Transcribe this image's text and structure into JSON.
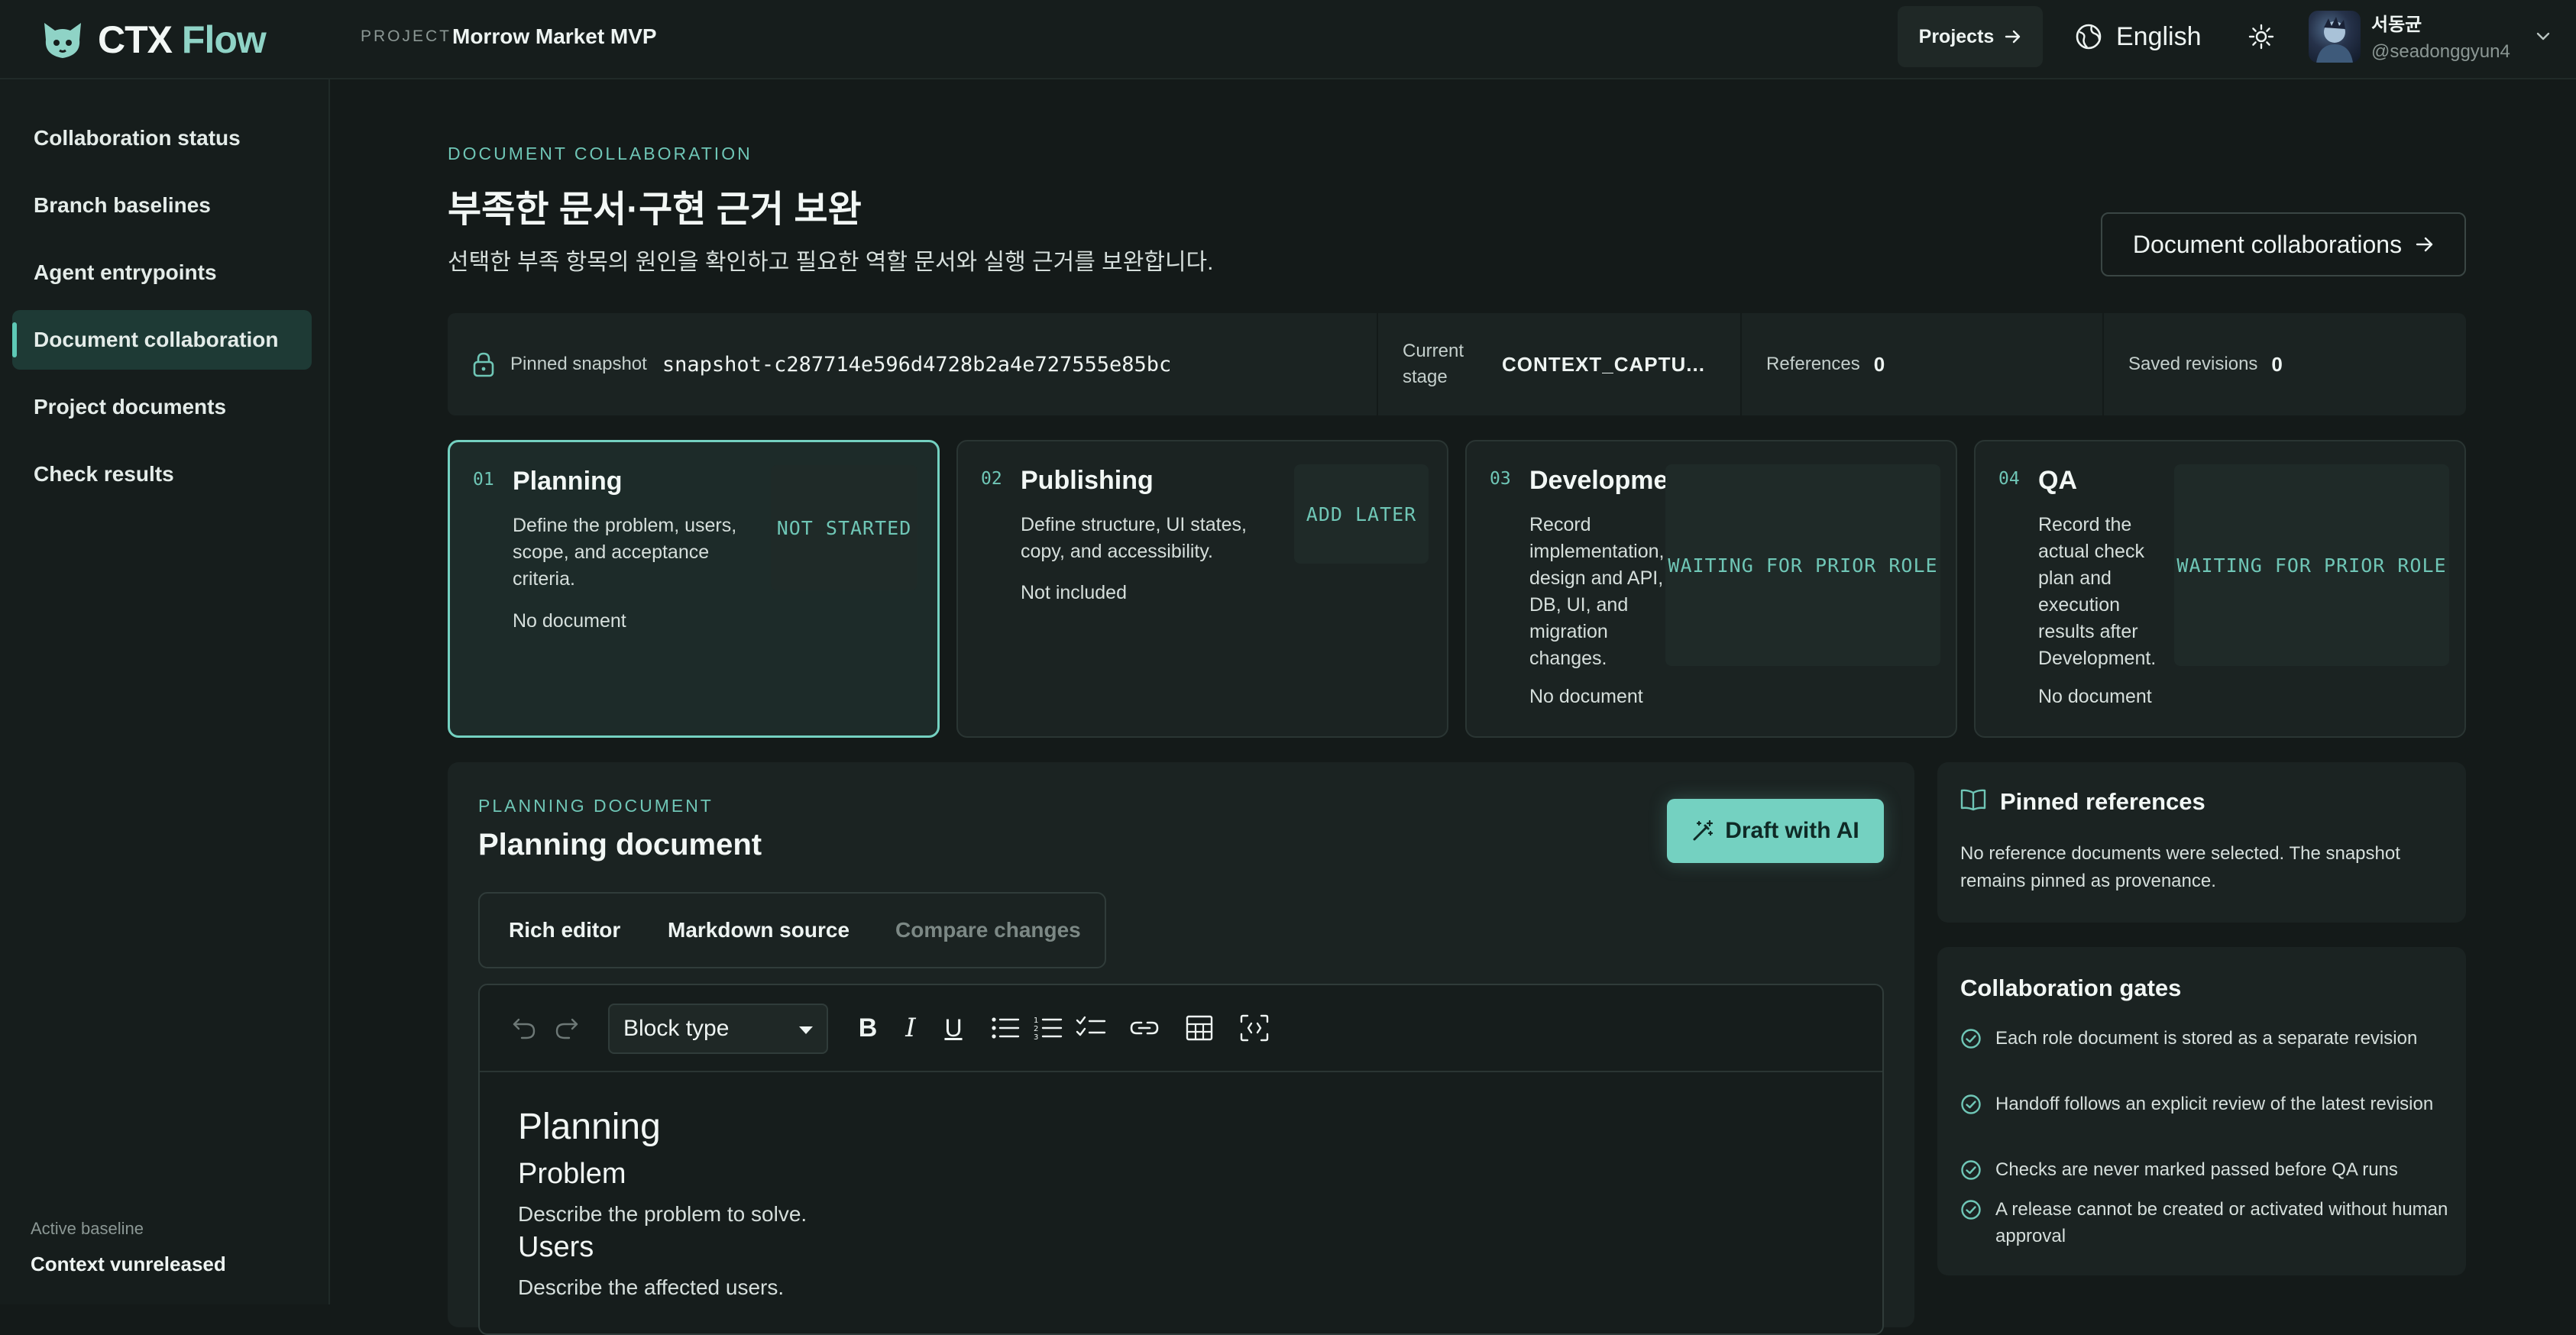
{
  "app": {
    "logo_ctx": "CTX",
    "logo_flow": "Flow",
    "project_tag": "PROJECT",
    "project_name": "Morrow Market MVP"
  },
  "header": {
    "projects_label": "Projects",
    "language": "English",
    "user_name": "서동균",
    "user_handle": "@seadonggyun4"
  },
  "sidebar": {
    "items": [
      {
        "label": "Collaboration status"
      },
      {
        "label": "Branch baselines"
      },
      {
        "label": "Agent entrypoints"
      },
      {
        "label": "Document collaboration",
        "active": true
      },
      {
        "label": "Project documents"
      },
      {
        "label": "Check results"
      }
    ],
    "baseline_label": "Active baseline",
    "baseline_value": "Context vunreleased"
  },
  "main": {
    "eyebrow": "DOCUMENT COLLABORATION",
    "title": "부족한 문서·구현 근거 보완",
    "subtitle": "선택한 부족 항목의 원인을 확인하고 필요한 역할 문서와 실행 근거를 보완합니다.",
    "doc_collab_button": "Document collaborations"
  },
  "snapshot": {
    "pinned_label": "Pinned snapshot",
    "pinned_value": "snapshot-c287714e596d4728b2a4e727555e85bc",
    "stage_label_1": "Current",
    "stage_label_2": "stage",
    "stage_value": "CONTEXT_CAPTU...",
    "references_label": "References",
    "references_value": "0",
    "revisions_label": "Saved revisions",
    "revisions_value": "0"
  },
  "roles": [
    {
      "num": "01",
      "title": "Planning",
      "desc": "Define the problem, users, scope, and acceptance criteria.",
      "foot": "No document",
      "status": "NOT STARTED"
    },
    {
      "num": "02",
      "title": "Publishing",
      "desc": "Define structure, UI states, copy, and accessibility.",
      "foot": "Not included",
      "status": "ADD LATER"
    },
    {
      "num": "03",
      "title": "Development",
      "desc": "Record implementation, design and API, DB, UI, and migration changes.",
      "foot": "No document",
      "status": "WAITING FOR PRIOR ROLE"
    },
    {
      "num": "04",
      "title": "QA",
      "desc": "Record the actual check plan and execution results after Development.",
      "foot": "No document",
      "status": "WAITING FOR PRIOR ROLE"
    }
  ],
  "doc": {
    "eyebrow": "PLANNING DOCUMENT",
    "title": "Planning document",
    "draft_button": "Draft with AI",
    "tabs": [
      "Rich editor",
      "Markdown source",
      "Compare changes"
    ],
    "block_type": "Block type",
    "content": {
      "h1": "Planning",
      "h2_problem": "Problem",
      "p_problem": "Describe the problem to solve.",
      "h2_users": "Users",
      "p_users": "Describe the affected users."
    }
  },
  "references_panel": {
    "title": "Pinned references",
    "text": "No reference documents were selected. The snapshot remains pinned as provenance."
  },
  "gates_panel": {
    "title": "Collaboration gates",
    "items": [
      "Each role document is stored as a separate revision",
      "Handoff follows an explicit review of the latest revision",
      "Checks are never marked passed before QA runs",
      "A release cannot be created or activated without human approval"
    ]
  },
  "colors": {
    "accent": "#74d1c1",
    "background": "#141a19",
    "panel": "#1b2322"
  }
}
